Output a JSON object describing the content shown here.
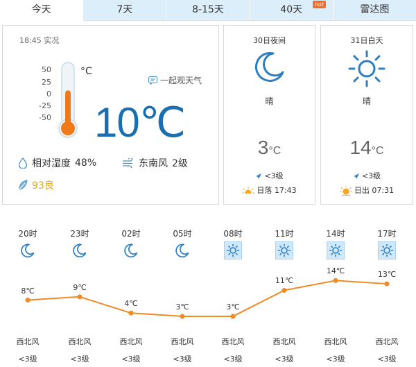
{
  "tabs": [
    {
      "label": "今天",
      "active": true
    },
    {
      "label": "7天"
    },
    {
      "label": "8-15天"
    },
    {
      "label": "40天",
      "badge": "hot"
    },
    {
      "label": "雷达图"
    }
  ],
  "current": {
    "obs_time": "18:45 实况",
    "scale": [
      "50",
      "25",
      "0",
      "-25",
      "-50"
    ],
    "scale_unit": "°C",
    "temperature": "10℃",
    "watch_label": "一起观天气",
    "humidity_label": "相对湿度",
    "humidity_value": "48%",
    "wind_label": "东南风",
    "wind_level": "2级",
    "aqi": "93良",
    "thermometer_level_pct": 60
  },
  "night": {
    "date": "30日夜间",
    "condition": "晴",
    "temp": "3",
    "temp_unit": "°C",
    "wind": "<3级",
    "sun_label": "日落",
    "sun_time": "17:43"
  },
  "day": {
    "date": "31日白天",
    "condition": "晴",
    "temp": "14",
    "temp_unit": "°C",
    "wind": "<3级",
    "sun_label": "日出",
    "sun_time": "07:31"
  },
  "hourly": [
    {
      "time": "20时",
      "icon": "moon",
      "temp": 8,
      "temp_label": "8℃",
      "wind_dir": "西北风",
      "wind_level": "<3级"
    },
    {
      "time": "23时",
      "icon": "moon",
      "temp": 9,
      "temp_label": "9℃",
      "wind_dir": "西北风",
      "wind_level": "<3级"
    },
    {
      "time": "02时",
      "icon": "moon",
      "temp": 4,
      "temp_label": "4℃",
      "wind_dir": "西北风",
      "wind_level": "<3级"
    },
    {
      "time": "05时",
      "icon": "moon",
      "temp": 3,
      "temp_label": "3℃",
      "wind_dir": "西北风",
      "wind_level": "<3级"
    },
    {
      "time": "08时",
      "icon": "sun",
      "temp": 3,
      "temp_label": "3℃",
      "wind_dir": "西北风",
      "wind_level": "<3级"
    },
    {
      "time": "11时",
      "icon": "sun",
      "temp": 11,
      "temp_label": "11℃",
      "wind_dir": "西北风",
      "wind_level": "<3级"
    },
    {
      "time": "14时",
      "icon": "sun",
      "temp": 14,
      "temp_label": "14℃",
      "wind_dir": "西北风",
      "wind_level": "<3级"
    },
    {
      "time": "17时",
      "icon": "sun",
      "temp": 13,
      "temp_label": "13℃",
      "wind_dir": "西北风",
      "wind_level": "<3级"
    }
  ],
  "colors": {
    "accent": "#1a6fb0",
    "line": "#f08a24",
    "tab_bg": "#dbeefa",
    "aqi": "#e2a81a"
  }
}
